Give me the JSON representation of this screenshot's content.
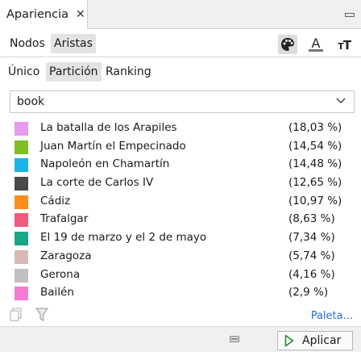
{
  "panel": {
    "title": "Apariencia"
  },
  "element_tabs": [
    {
      "label": "Nodos",
      "active": false
    },
    {
      "label": "Aristas",
      "active": true
    }
  ],
  "mode_tabs": [
    {
      "label": "Único",
      "active": false
    },
    {
      "label": "Partición",
      "active": true
    },
    {
      "label": "Ranking",
      "active": false
    }
  ],
  "tools": [
    {
      "icon": "palette-icon",
      "active": true
    },
    {
      "icon": "label-color-icon",
      "active": false
    },
    {
      "icon": "label-size-icon",
      "active": false
    }
  ],
  "attribute_select": {
    "value": "book"
  },
  "partitions": [
    {
      "name": "La batalla de los Arapiles",
      "pct": "(18,03 %)",
      "color": "#e899f0"
    },
    {
      "name": "Juan Martín el Empecinado",
      "pct": "(14,54 %)",
      "color": "#7fbf1f"
    },
    {
      "name": "Napoleón en Chamartín",
      "pct": "(14,48 %)",
      "color": "#19b4e8"
    },
    {
      "name": "La corte de Carlos IV",
      "pct": "(12,65 %)",
      "color": "#4a4a4a"
    },
    {
      "name": "Cádiz",
      "pct": "(10,97 %)",
      "color": "#ff8c1a"
    },
    {
      "name": "Trafalgar",
      "pct": "(8,63 %)",
      "color": "#f25a7d"
    },
    {
      "name": "El 19 de marzo y el 2 de mayo",
      "pct": "(7,34 %)",
      "color": "#16a884"
    },
    {
      "name": "Zaragoza",
      "pct": "(5,74 %)",
      "color": "#d9b8b8"
    },
    {
      "name": "Gerona",
      "pct": "(4,16 %)",
      "color": "#c0c0c0"
    },
    {
      "name": "Bailén",
      "pct": "(2,9 %)",
      "color": "#f57ad2"
    }
  ],
  "footer": {
    "palette_link": "Paleta..."
  },
  "actions": {
    "apply_label": "Aplicar"
  }
}
